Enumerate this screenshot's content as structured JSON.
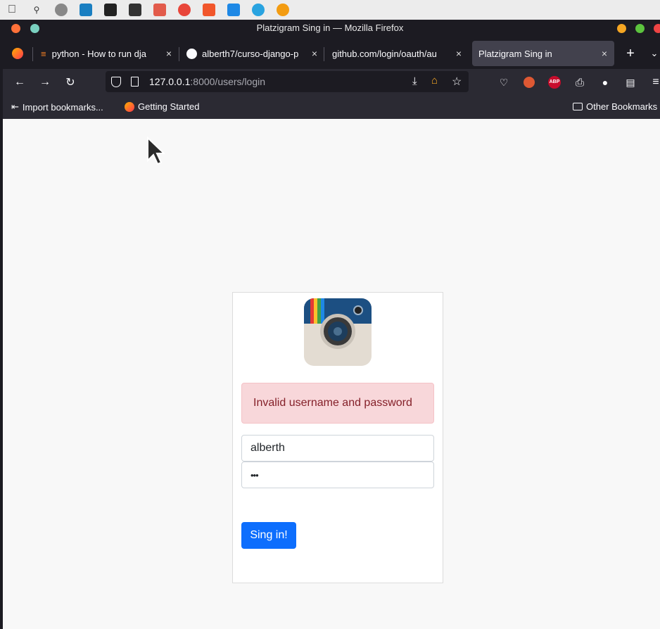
{
  "window": {
    "title": "Platzigram Sing in — Mozilla Firefox"
  },
  "tabs": [
    {
      "label": "python - How to run dja"
    },
    {
      "label": "alberth7/curso-django-p"
    },
    {
      "label": "github.com/login/oauth/au"
    },
    {
      "label": "Platzigram Sing in"
    }
  ],
  "url": {
    "host": "127.0.0.1",
    "path": ":8000/users/login"
  },
  "bookmarks": {
    "import": "Import bookmarks...",
    "getting_started": "Getting Started",
    "other": "Other Bookmarks"
  },
  "login": {
    "error": "Invalid username and password",
    "username": "alberth",
    "password": "•••",
    "submit": "Sing in!"
  },
  "colors": {
    "accent": "#0d6efd",
    "alert_bg": "#f8d7da",
    "alert_text": "#842029"
  },
  "icons": {
    "adblock": "ABP"
  }
}
